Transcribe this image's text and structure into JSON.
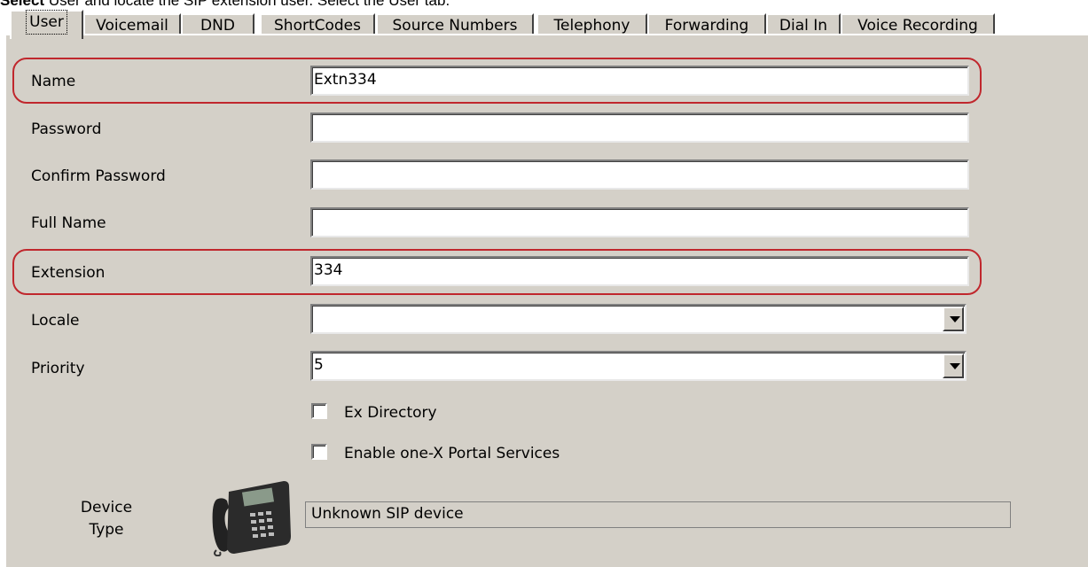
{
  "caption": {
    "prefix": "Select",
    "text": "User and locate the SIP extension user. Select the User tab."
  },
  "tabs": [
    {
      "label": "User",
      "active": true
    },
    {
      "label": "Voicemail"
    },
    {
      "label": "DND"
    },
    {
      "label": "ShortCodes"
    },
    {
      "label": "Source Numbers"
    },
    {
      "label": "Telephony"
    },
    {
      "label": "Forwarding"
    },
    {
      "label": "Dial In"
    },
    {
      "label": "Voice Recording"
    }
  ],
  "form": {
    "name": {
      "label": "Name",
      "value": "Extn334"
    },
    "password": {
      "label": "Password",
      "value": ""
    },
    "confirm_password": {
      "label": "Confirm Password",
      "value": ""
    },
    "full_name": {
      "label": "Full Name",
      "value": ""
    },
    "extension": {
      "label": "Extension",
      "value": "334"
    },
    "locale": {
      "label": "Locale",
      "value": ""
    },
    "priority": {
      "label": "Priority",
      "value": "5"
    },
    "ex_directory": {
      "label": "Ex Directory",
      "checked": false
    },
    "one_x_portal": {
      "label": "Enable one-X Portal Services",
      "checked": false
    },
    "device_type": {
      "label_line1": "Device",
      "label_line2": "Type",
      "value": "Unknown SIP device"
    }
  },
  "highlight_color": "#c0272d",
  "icons": {
    "device": "desk-phone-icon",
    "dropdown": "chevron-down-icon"
  }
}
